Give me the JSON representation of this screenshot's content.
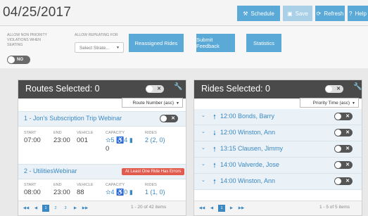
{
  "header": {
    "date": "04/25/2017",
    "buttons": {
      "schedule": "Schedule",
      "save": "Save",
      "refresh": "Refresh",
      "help": "Help"
    }
  },
  "options": {
    "nonpriority_label_1": "ALLOW NON PRIORITY",
    "nonpriority_label_2": "VIOLATIONS WHEN",
    "nonpriority_label_3": "SEATING",
    "repeating_label": "ALLOW REPEATING FOR",
    "select_placeholder": "Select Strate...",
    "toggle_text": "NO",
    "reassigned_label": "Reassigned Rides",
    "feedback_label": "Submit Feedback",
    "statistics_label": "Statistics"
  },
  "routes_panel": {
    "title": "Routes Selected: 0",
    "sort": "Route Number (asc)",
    "routes": [
      {
        "name": "1 - Jon's Subscription Trip Webinar",
        "start": "07:00",
        "end": "23:00",
        "vehicle": "001",
        "capacity_a": "5",
        "capacity_b": "4",
        "capacity_extra": "0",
        "rides": "2",
        "rides_detail": "(2, 0)",
        "error": ""
      },
      {
        "name": "2 - UtilitiesWebinar",
        "start": "08:00",
        "end": "23:00",
        "vehicle": "88",
        "capacity_a": "4",
        "capacity_b": "0",
        "capacity_extra": "",
        "rides": "1",
        "rides_detail": "(1, 0)",
        "error": "At Least One Ride Has Errors"
      }
    ],
    "col_labels": {
      "start": "START",
      "end": "END",
      "vehicle": "VEHICLE",
      "capacity": "CAPACITY",
      "rides": "RIDES"
    },
    "pager": {
      "pages": [
        "1",
        "2",
        "3"
      ],
      "info": "1 - 20 of 42 items"
    }
  },
  "rides_panel": {
    "title": "Rides Selected: 0",
    "sort": "Priority Time (asc)",
    "rides": [
      {
        "direction": "up",
        "text": "12:00 Bonds, Barry"
      },
      {
        "direction": "down",
        "text": "12:00 Winston, Ann"
      },
      {
        "direction": "up",
        "text": "13:15 Clausen, Jimmy"
      },
      {
        "direction": "up",
        "text": "14:00 Valverde, Jose"
      },
      {
        "direction": "up",
        "text": "14:00 Winston, Ann"
      }
    ],
    "pager": {
      "pages": [
        "1"
      ],
      "info": "1 - 5 of 5 items"
    }
  },
  "colors": {
    "accent": "#5aa9d6",
    "header_dark": "#4a4a4a",
    "error": "#e25b4e",
    "link": "#3b88c3"
  }
}
